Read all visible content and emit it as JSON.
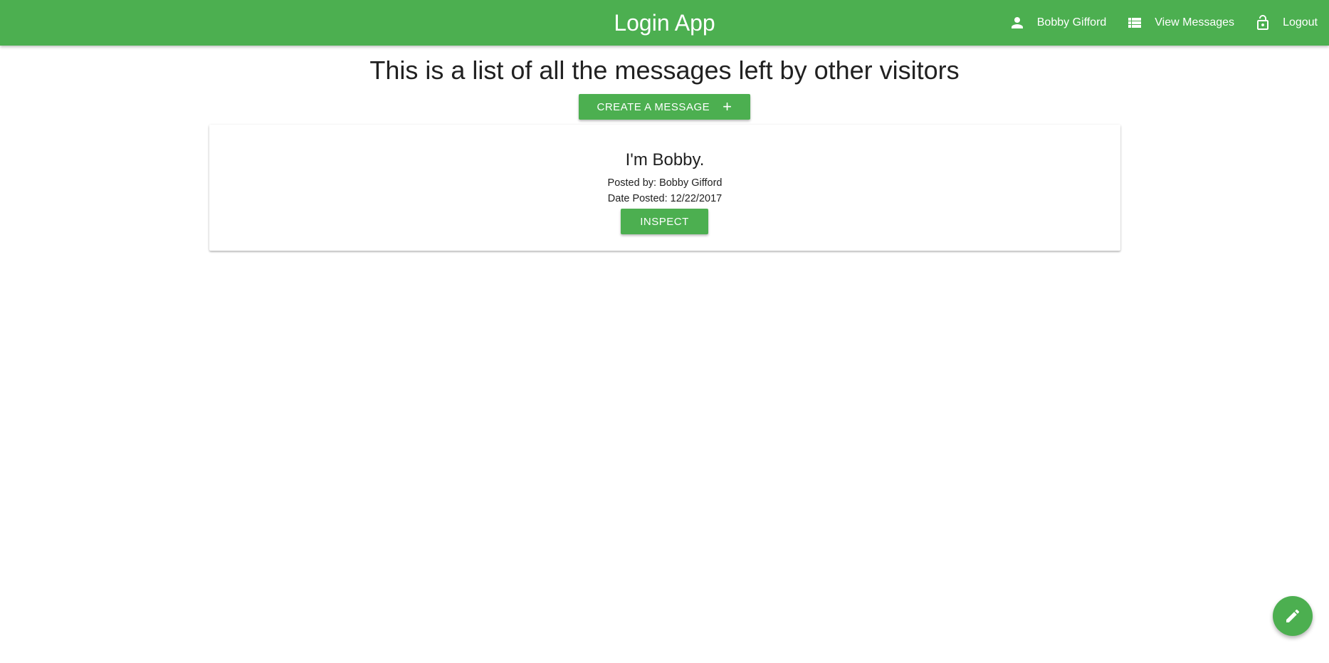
{
  "header": {
    "title": "Login App",
    "nav": [
      {
        "label": "Bobby Gifford",
        "icon": "person-icon"
      },
      {
        "label": "View Messages",
        "icon": "list-icon"
      },
      {
        "label": "Logout",
        "icon": "lock-open-icon"
      }
    ]
  },
  "main": {
    "heading": "This is a list of all the messages left by other visitors",
    "create_button_label": "CREATE A MESSAGE",
    "create_button_icon": "+",
    "messages": [
      {
        "title": "I'm Bobby.",
        "posted_by": "Posted by: Bobby Gifford",
        "date_posted": "Date Posted: 12/22/2017",
        "action_label": "INSPECT"
      }
    ]
  },
  "fab": {
    "icon": "pencil-icon"
  },
  "colors": {
    "primary": "#4caf50",
    "text": "#212121",
    "background": "#ffffff"
  }
}
